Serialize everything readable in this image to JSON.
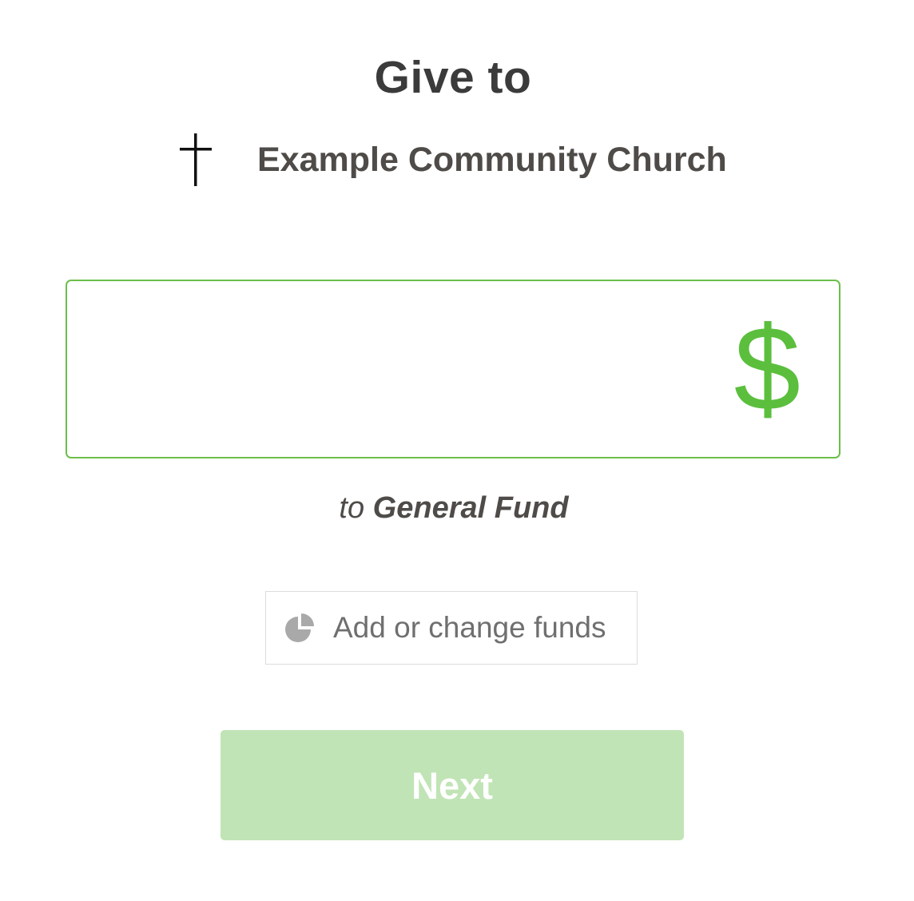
{
  "header": {
    "title": "Give to"
  },
  "organization": {
    "icon": "cross-icon",
    "name": "Example Community Church"
  },
  "amount": {
    "value": "",
    "currency_symbol": "$",
    "accent_color": "#5bbf3d"
  },
  "fund": {
    "prefix": "to",
    "name": "General Fund"
  },
  "change_funds": {
    "icon": "pie-chart-icon",
    "label": "Add or change funds"
  },
  "next_button": {
    "label": "Next",
    "color": "#c1e4b6",
    "state": "disabled"
  }
}
